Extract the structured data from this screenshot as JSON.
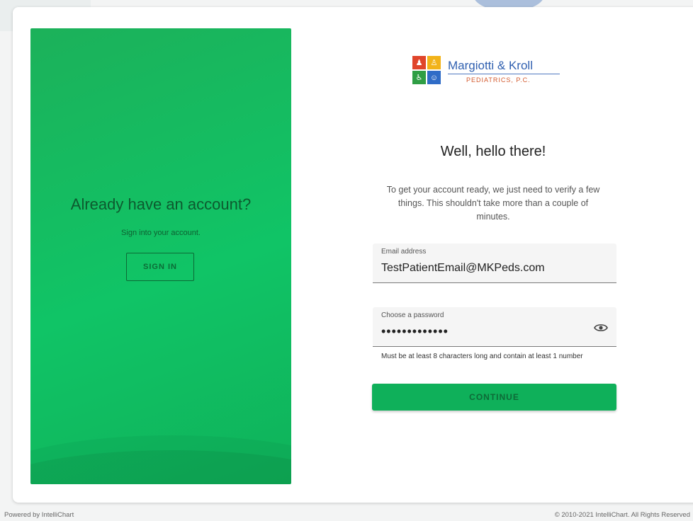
{
  "promo": {
    "title": "Already have an account?",
    "subtitle": "Sign into your account.",
    "signin_label": "SIGN IN",
    "colors": {
      "panel": "#10c466",
      "text": "#0d5a2f"
    }
  },
  "logo": {
    "name": "Margiotti & Kroll",
    "subtitle": "PEDIATRICS, P.C.",
    "icons": [
      "child-figure-icon",
      "parent-figure-icon",
      "wheelchair-icon",
      "person-icon"
    ],
    "colors": [
      "#e0452b",
      "#f2b319",
      "#2f9e45",
      "#2f6cc7"
    ]
  },
  "form": {
    "heading": "Well, hello there!",
    "intro": "To get your account ready, we just need to verify a few things. This shouldn't take more than a couple of minutes.",
    "email_label": "Email address",
    "email_value": "TestPatientEmail@MKPeds.com",
    "password_label": "Choose a password",
    "password_value": "•••••••••••••",
    "password_hint": "Must be at least 8 characters long and contain at least 1 number",
    "continue_label": "CONTINUE",
    "accent": "#0fb05a"
  },
  "footer": {
    "powered_by": "Powered by IntelliChart",
    "copyright": "© 2010-2021 IntelliChart. All Rights Reserved"
  }
}
